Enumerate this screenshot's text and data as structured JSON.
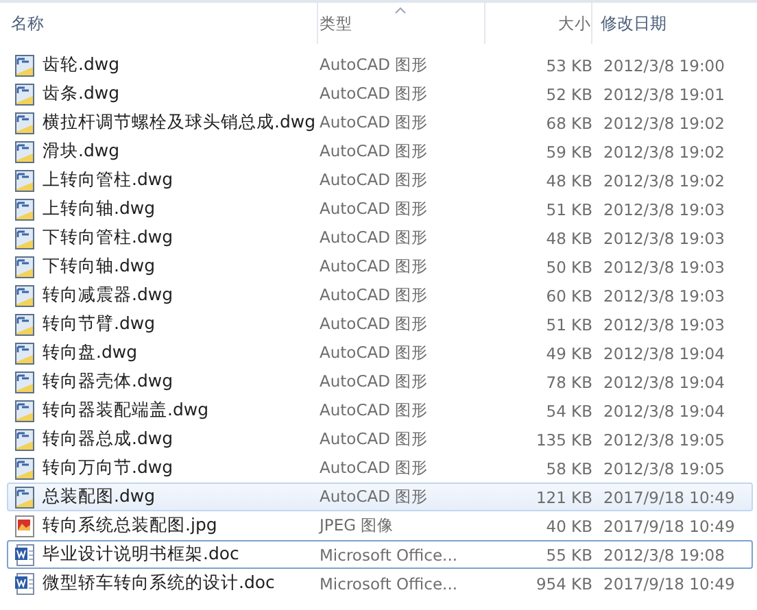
{
  "columns": [
    {
      "label": "名称",
      "sorted": false
    },
    {
      "label": "类型",
      "sorted": true
    },
    {
      "label": "大小",
      "sorted": false
    },
    {
      "label": "修改日期",
      "sorted": false
    }
  ],
  "files": [
    {
      "name": "齿轮.dwg",
      "kind": "dwg",
      "type": "AutoCAD 图形",
      "size": "53 KB",
      "modified": "2012/3/8 19:00",
      "selected": false,
      "focused": false
    },
    {
      "name": "齿条.dwg",
      "kind": "dwg",
      "type": "AutoCAD 图形",
      "size": "52 KB",
      "modified": "2012/3/8 19:01",
      "selected": false,
      "focused": false
    },
    {
      "name": "横拉杆调节螺栓及球头销总成.dwg",
      "kind": "dwg",
      "type": "AutoCAD 图形",
      "size": "68 KB",
      "modified": "2012/3/8 19:02",
      "selected": false,
      "focused": false
    },
    {
      "name": "滑块.dwg",
      "kind": "dwg",
      "type": "AutoCAD 图形",
      "size": "59 KB",
      "modified": "2012/3/8 19:02",
      "selected": false,
      "focused": false
    },
    {
      "name": "上转向管柱.dwg",
      "kind": "dwg",
      "type": "AutoCAD 图形",
      "size": "48 KB",
      "modified": "2012/3/8 19:02",
      "selected": false,
      "focused": false
    },
    {
      "name": "上转向轴.dwg",
      "kind": "dwg",
      "type": "AutoCAD 图形",
      "size": "51 KB",
      "modified": "2012/3/8 19:03",
      "selected": false,
      "focused": false
    },
    {
      "name": "下转向管柱.dwg",
      "kind": "dwg",
      "type": "AutoCAD 图形",
      "size": "48 KB",
      "modified": "2012/3/8 19:03",
      "selected": false,
      "focused": false
    },
    {
      "name": "下转向轴.dwg",
      "kind": "dwg",
      "type": "AutoCAD 图形",
      "size": "50 KB",
      "modified": "2012/3/8 19:03",
      "selected": false,
      "focused": false
    },
    {
      "name": "转向减震器.dwg",
      "kind": "dwg",
      "type": "AutoCAD 图形",
      "size": "60 KB",
      "modified": "2012/3/8 19:03",
      "selected": false,
      "focused": false
    },
    {
      "name": "转向节臂.dwg",
      "kind": "dwg",
      "type": "AutoCAD 图形",
      "size": "51 KB",
      "modified": "2012/3/8 19:03",
      "selected": false,
      "focused": false
    },
    {
      "name": "转向盘.dwg",
      "kind": "dwg",
      "type": "AutoCAD 图形",
      "size": "49 KB",
      "modified": "2012/3/8 19:04",
      "selected": false,
      "focused": false
    },
    {
      "name": "转向器壳体.dwg",
      "kind": "dwg",
      "type": "AutoCAD 图形",
      "size": "78 KB",
      "modified": "2012/3/8 19:04",
      "selected": false,
      "focused": false
    },
    {
      "name": "转向器装配端盖.dwg",
      "kind": "dwg",
      "type": "AutoCAD 图形",
      "size": "54 KB",
      "modified": "2012/3/8 19:04",
      "selected": false,
      "focused": false
    },
    {
      "name": "转向器总成.dwg",
      "kind": "dwg",
      "type": "AutoCAD 图形",
      "size": "135 KB",
      "modified": "2012/3/8 19:05",
      "selected": false,
      "focused": false
    },
    {
      "name": "转向万向节.dwg",
      "kind": "dwg",
      "type": "AutoCAD 图形",
      "size": "58 KB",
      "modified": "2012/3/8 19:05",
      "selected": false,
      "focused": false
    },
    {
      "name": "总装配图.dwg",
      "kind": "dwg",
      "type": "AutoCAD 图形",
      "size": "121 KB",
      "modified": "2017/9/18 10:49",
      "selected": true,
      "focused": false
    },
    {
      "name": "转向系统总装配图.jpg",
      "kind": "jpg",
      "type": "JPEG 图像",
      "size": "40 KB",
      "modified": "2017/9/18 10:49",
      "selected": false,
      "focused": false
    },
    {
      "name": "毕业设计说明书框架.doc",
      "kind": "doc",
      "type": "Microsoft Office...",
      "size": "55 KB",
      "modified": "2012/3/8 19:08",
      "selected": false,
      "focused": true
    },
    {
      "name": "微型轿车转向系统的设计.doc",
      "kind": "doc",
      "type": "Microsoft Office...",
      "size": "954 KB",
      "modified": "2017/9/18 10:49",
      "selected": false,
      "focused": false
    }
  ]
}
